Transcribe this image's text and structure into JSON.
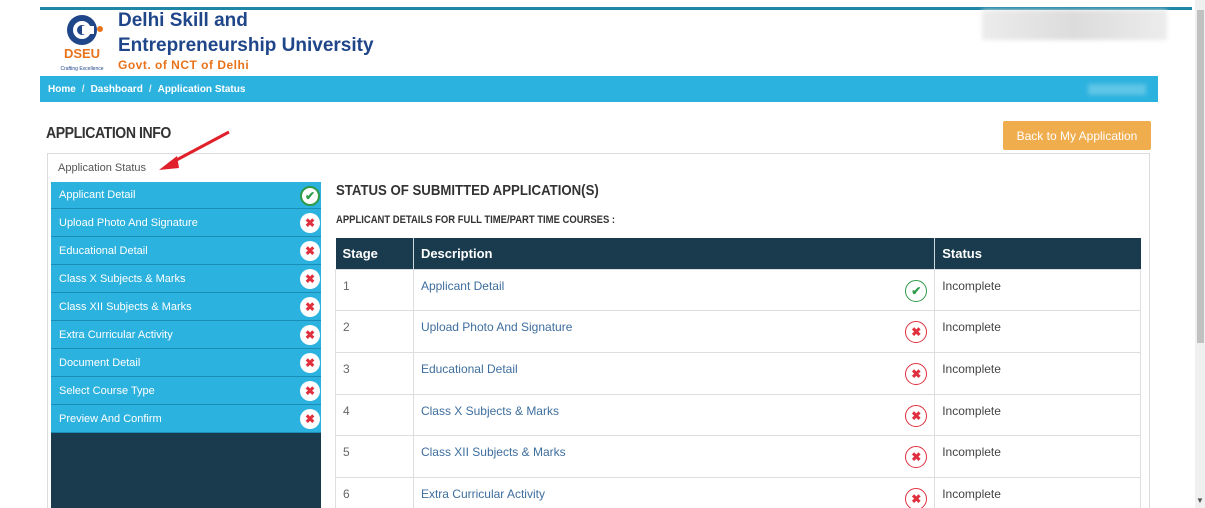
{
  "header": {
    "university_line1": "Delhi Skill and",
    "university_line2": "Entrepreneurship University",
    "govt_line": "Govt. of NCT of Delhi",
    "logo_text": "DSEU",
    "logo_tagline": "Crafting Excellence"
  },
  "breadcrumb": {
    "items": [
      "Home",
      "Dashboard",
      "Application Status"
    ],
    "separator": "/"
  },
  "page": {
    "title": "APPLICATION INFO",
    "back_button": "Back to My Application",
    "tab_label": "Application Status"
  },
  "sidebar": {
    "items": [
      {
        "label": "Applicant Detail",
        "status": "complete"
      },
      {
        "label": "Upload Photo And Signature",
        "status": "incomplete"
      },
      {
        "label": "Educational Detail",
        "status": "incomplete"
      },
      {
        "label": "Class X Subjects & Marks",
        "status": "incomplete"
      },
      {
        "label": "Class XII Subjects & Marks",
        "status": "incomplete"
      },
      {
        "label": "Extra Curricular Activity",
        "status": "incomplete"
      },
      {
        "label": "Document Detail",
        "status": "incomplete"
      },
      {
        "label": "Select Course Type",
        "status": "incomplete"
      },
      {
        "label": "Preview And Confirm",
        "status": "incomplete"
      }
    ]
  },
  "status_section": {
    "title": "STATUS OF SUBMITTED APPLICATION(S)",
    "subtitle": "APPLICANT DETAILS FOR FULL TIME/PART TIME COURSES :",
    "columns": [
      "Stage",
      "Description",
      "Status"
    ],
    "rows": [
      {
        "stage": "1",
        "description": "Applicant Detail",
        "icon": "check-icon",
        "status": "Incomplete"
      },
      {
        "stage": "2",
        "description": "Upload Photo And Signature",
        "icon": "cross-icon",
        "status": "Incomplete"
      },
      {
        "stage": "3",
        "description": "Educational Detail",
        "icon": "cross-icon",
        "status": "Incomplete"
      },
      {
        "stage": "4",
        "description": "Class X Subjects & Marks",
        "icon": "cross-icon",
        "status": "Incomplete"
      },
      {
        "stage": "5",
        "description": "Class XII Subjects & Marks",
        "icon": "cross-icon",
        "status": "Incomplete"
      },
      {
        "stage": "6",
        "description": "Extra Curricular Activity",
        "icon": "cross-icon",
        "status": "Incomplete"
      }
    ]
  },
  "colors": {
    "primary_dark": "#1a3b4d",
    "accent_blue": "#2cb2df",
    "button_orange": "#f0ad4e",
    "success_green": "#2e9b4a",
    "error_red": "#e0303f",
    "brand_navy": "#20468a",
    "brand_orange": "#e8731b"
  }
}
